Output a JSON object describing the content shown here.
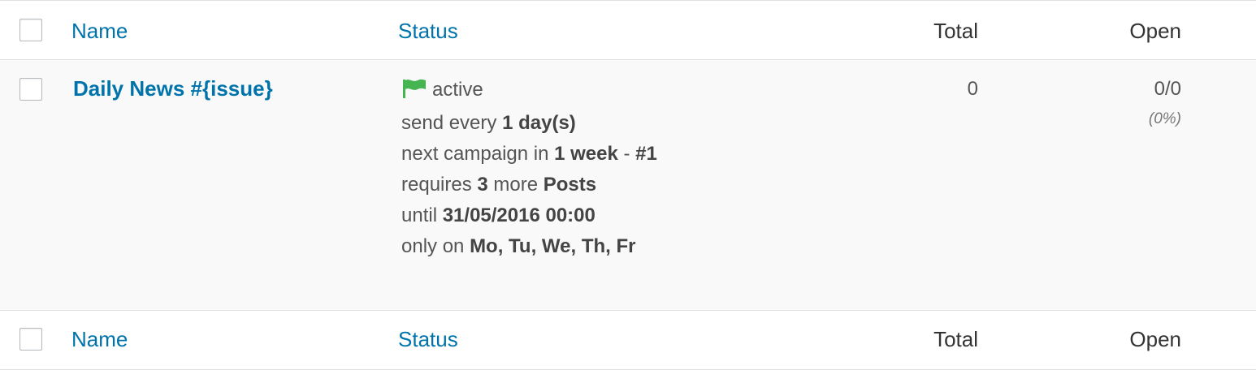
{
  "columns": {
    "name": "Name",
    "status": "Status",
    "total": "Total",
    "open": "Open"
  },
  "rows": [
    {
      "name": "Daily News #{issue}",
      "status": {
        "state": "active",
        "state_color": "#46b450",
        "line1_prefix": "send every ",
        "line1_bold": "1 day(s)",
        "line2_prefix": "next campaign in ",
        "line2_bold": "1 week",
        "line2_suffix": " - ",
        "line2_bold2": "#1",
        "line3_prefix": "requires ",
        "line3_bold": "3",
        "line3_mid": " more ",
        "line3_bold2": "Posts",
        "line4_prefix": "until ",
        "line4_bold": "31/05/2016 00:00",
        "line5_prefix": "only on ",
        "line5_bold": "Mo, Tu, We, Th, Fr"
      },
      "total": "0",
      "open": "0/0",
      "open_pct": "(0%)"
    }
  ],
  "icons": {
    "status_flag": "flag-icon"
  },
  "colors": {
    "link": "#0073aa",
    "row_bg": "#f9f9f9",
    "border": "#e1e1e1"
  }
}
